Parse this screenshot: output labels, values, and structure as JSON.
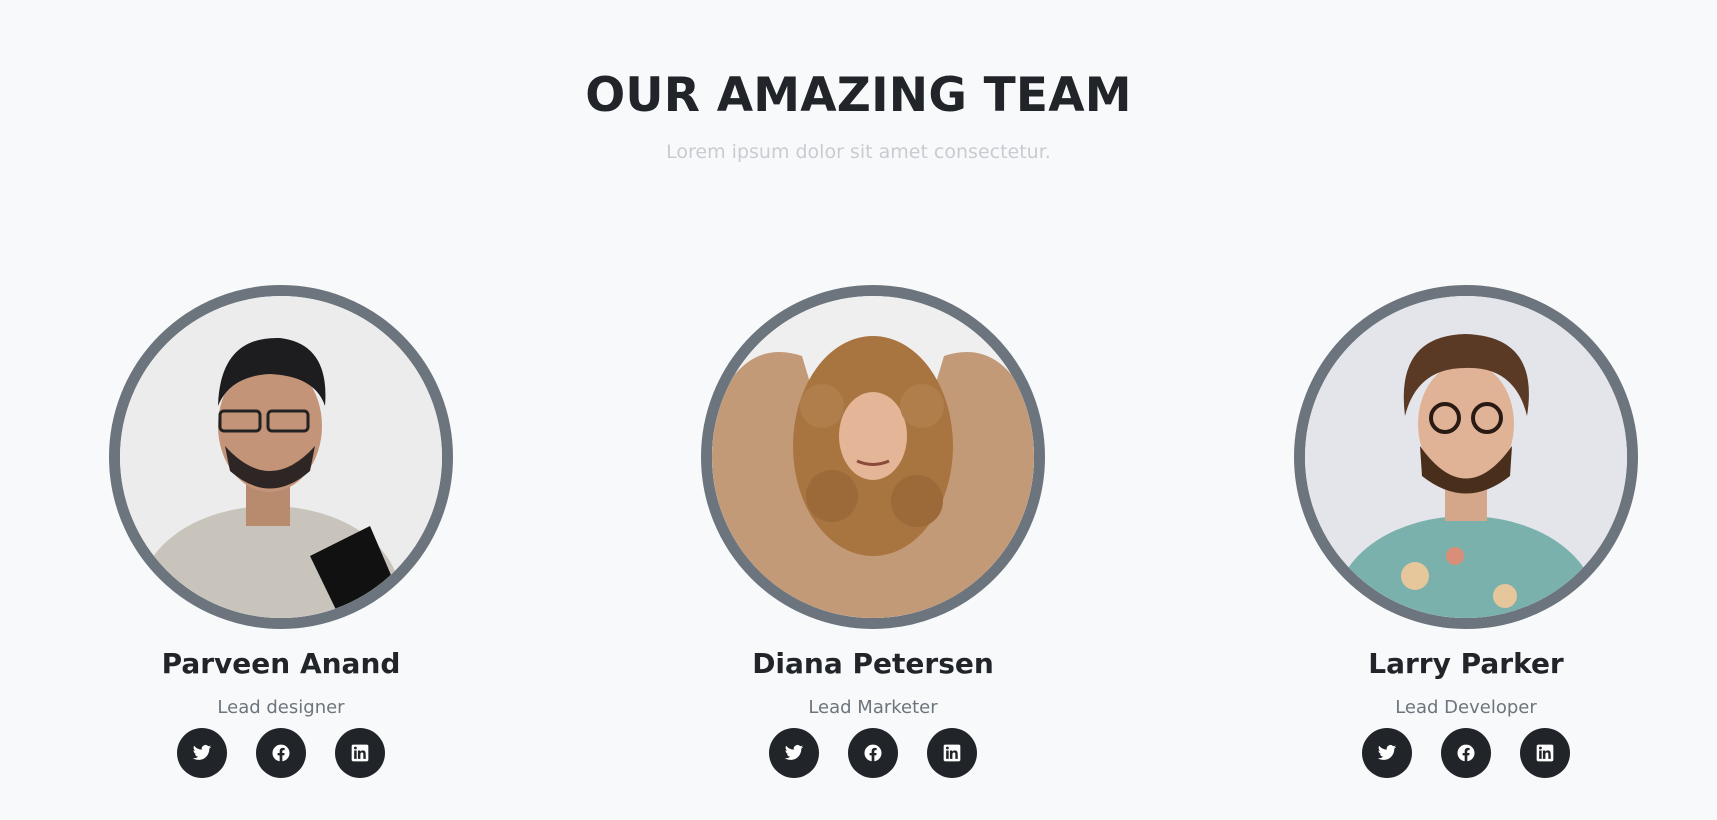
{
  "section": {
    "title": "OUR AMAZING TEAM",
    "subtitle": "Lorem ipsum dolor sit amet consectetur."
  },
  "colors": {
    "background": "#f8f9fa",
    "avatar_border": "#6c757d",
    "social_button": "#212529",
    "heading": "#212529",
    "subtitle": "#c8ccd2",
    "role": "#6c757d"
  },
  "members": [
    {
      "name": "Parveen Anand",
      "role": "Lead designer",
      "socials": [
        "twitter-icon",
        "facebook-icon",
        "linkedin-icon"
      ]
    },
    {
      "name": "Diana Petersen",
      "role": "Lead Marketer",
      "socials": [
        "twitter-icon",
        "facebook-icon",
        "linkedin-icon"
      ]
    },
    {
      "name": "Larry Parker",
      "role": "Lead Developer",
      "socials": [
        "twitter-icon",
        "facebook-icon",
        "linkedin-icon"
      ]
    }
  ]
}
